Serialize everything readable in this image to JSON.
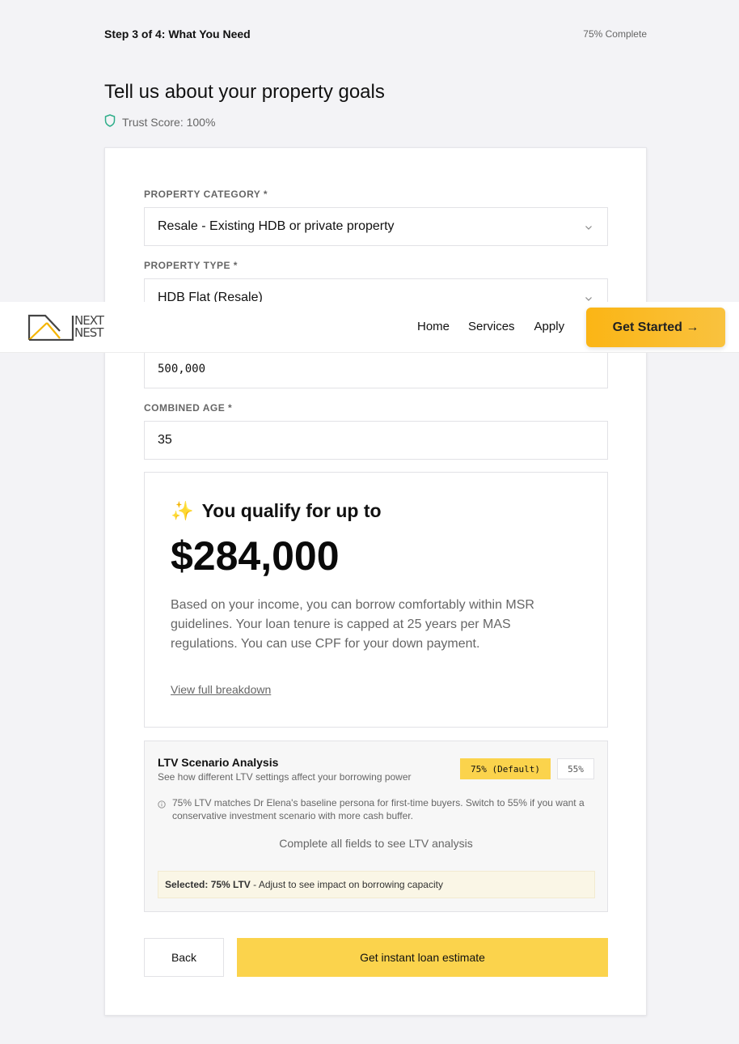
{
  "progress": {
    "step_label": "Step 3 of 4: What You Need",
    "complete_label": "75% Complete",
    "percent": 75
  },
  "page": {
    "title": "Tell us about your property goals",
    "trust_score": "Trust Score: 100%"
  },
  "form": {
    "property_category": {
      "label": "PROPERTY CATEGORY *",
      "value": "Resale - Existing HDB or private property"
    },
    "property_type": {
      "label": "PROPERTY TYPE *",
      "value": "HDB Flat (Resale)"
    },
    "price": {
      "value": "500,000"
    },
    "combined_age": {
      "label": "COMBINED AGE *",
      "value": "35"
    }
  },
  "qualify": {
    "emoji": "✨",
    "heading": "You qualify for up to",
    "amount": "$284,000",
    "description": "Based on your income, you can borrow comfortably within MSR guidelines. Your loan tenure is capped at 25 years per MAS regulations. You can use CPF for your down payment.",
    "link": "View full breakdown"
  },
  "ltv": {
    "title": "LTV Scenario Analysis",
    "subtitle": "See how different LTV settings affect your borrowing power",
    "options": [
      "75% (Default)",
      "55%"
    ],
    "selected_option": "75% (Default)",
    "note": "75% LTV matches Dr Elena's baseline persona for first-time buyers. Switch to 55% if you want a conservative investment scenario with more cash buffer.",
    "empty_message": "Complete all fields to see LTV analysis",
    "selected_bold": "Selected: 75% LTV",
    "selected_rest": " - Adjust to see impact on borrowing capacity"
  },
  "buttons": {
    "back": "Back",
    "estimate": "Get instant loan estimate"
  },
  "navbar": {
    "logo_line1": "NEXT",
    "logo_line2": "NEST",
    "links": [
      "Home",
      "Services",
      "Apply"
    ],
    "cta": "Get Started →"
  },
  "colors": {
    "accent": "#fbd34c",
    "cta_gradient_start": "#fbb515",
    "trust_icon": "#2fae8a",
    "background": "#f3f3f6"
  },
  "icons": {
    "trust": "shield-icon",
    "dropdown": "chevron-down-icon",
    "note": "info-icon"
  }
}
